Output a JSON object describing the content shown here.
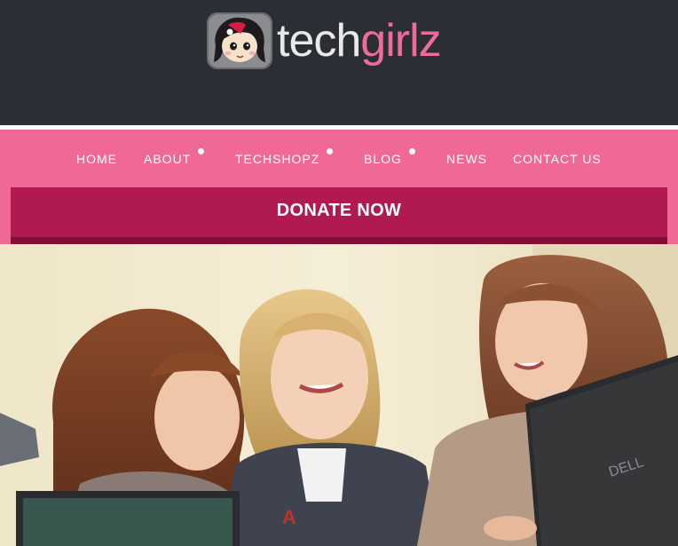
{
  "brand": {
    "logo_part1": "tech",
    "logo_part2": "girlz",
    "logo_icon": "cartoon-girl-face-icon"
  },
  "nav": {
    "items": [
      {
        "label": "HOME",
        "has_dropdown": false
      },
      {
        "label": "ABOUT",
        "has_dropdown": true
      },
      {
        "label": "TECHSHOPZ",
        "has_dropdown": true
      },
      {
        "label": "BLOG",
        "has_dropdown": true
      },
      {
        "label": "NEWS",
        "has_dropdown": false
      },
      {
        "label": "CONTACT US",
        "has_dropdown": false
      }
    ]
  },
  "donate": {
    "label": "DONATE NOW"
  },
  "hero": {
    "image_subject": "three girls smiling at laptops",
    "laptop_brand": "DELL"
  },
  "colors": {
    "header_bg": "#2b2f35",
    "nav_bg": "#f06895",
    "donate_bg": "#b01a50",
    "brand_pink": "#ef6c9a"
  }
}
